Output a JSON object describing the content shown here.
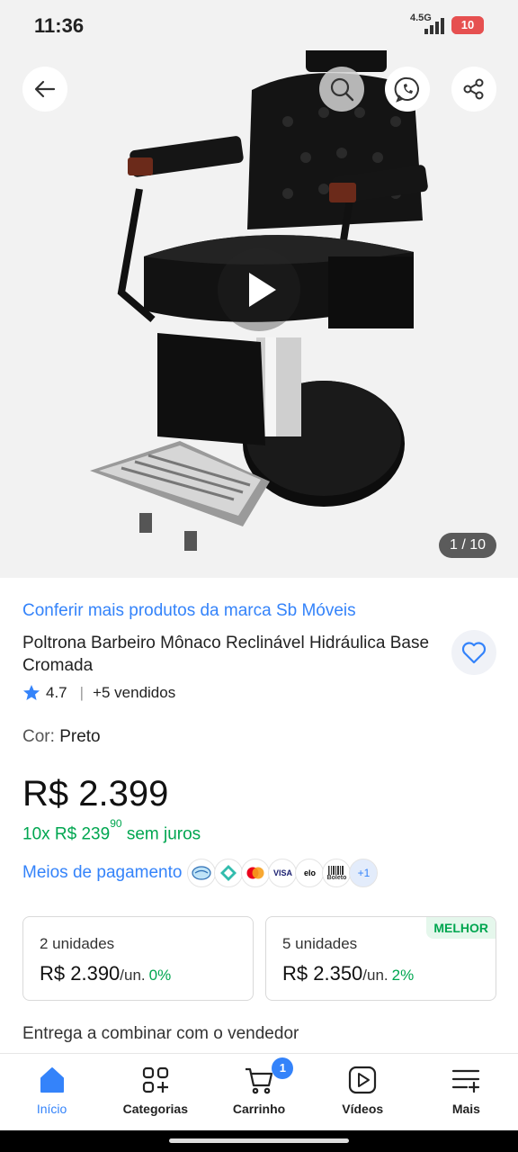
{
  "status_bar": {
    "time": "11:36",
    "network": "4.5G",
    "battery": "10"
  },
  "gallery": {
    "counter": "1 / 10"
  },
  "product": {
    "brand_link": "Conferir mais produtos da marca Sb Móveis",
    "title": "Poltrona Barbeiro Mônaco Reclinável Hidráulica Base Cromada",
    "rating": "4.7",
    "sold": "+5 vendidos",
    "color_label": "Cor:",
    "color_value": "Preto",
    "price": "R$ 2.399",
    "installments_prefix": "10x R$ 239",
    "installments_cents": "90",
    "installments_suffix": "sem juros",
    "payment_link": "Meios de pagamento",
    "payment_more": "+1",
    "delivery": "Entrega a combinar com o vendedor"
  },
  "payment_methods": [
    "mercado-pago-icon",
    "pix-icon",
    "mastercard-icon",
    "visa-icon",
    "elo-icon",
    "boleto-icon"
  ],
  "payment_labels": {
    "visa": "VISA",
    "elo": "elo",
    "boleto": "Boleto"
  },
  "quantity_offers": [
    {
      "units": "2 unidades",
      "price": "R$ 2.390",
      "per": "/un.",
      "discount": "0%"
    },
    {
      "units": "5 unidades",
      "price": "R$ 2.350",
      "per": "/un.",
      "discount": "2%",
      "badge": "MELHOR"
    }
  ],
  "bottom_nav": [
    {
      "label": "Início",
      "icon": "home-icon",
      "active": true
    },
    {
      "label": "Categorias",
      "icon": "categories-icon"
    },
    {
      "label": "Carrinho",
      "icon": "cart-icon",
      "badge": "1"
    },
    {
      "label": "Vídeos",
      "icon": "play-video-icon"
    },
    {
      "label": "Mais",
      "icon": "more-menu-icon"
    }
  ],
  "colors": {
    "accent": "#3483fa",
    "green": "#00a650",
    "background": "#f2f2f2"
  }
}
